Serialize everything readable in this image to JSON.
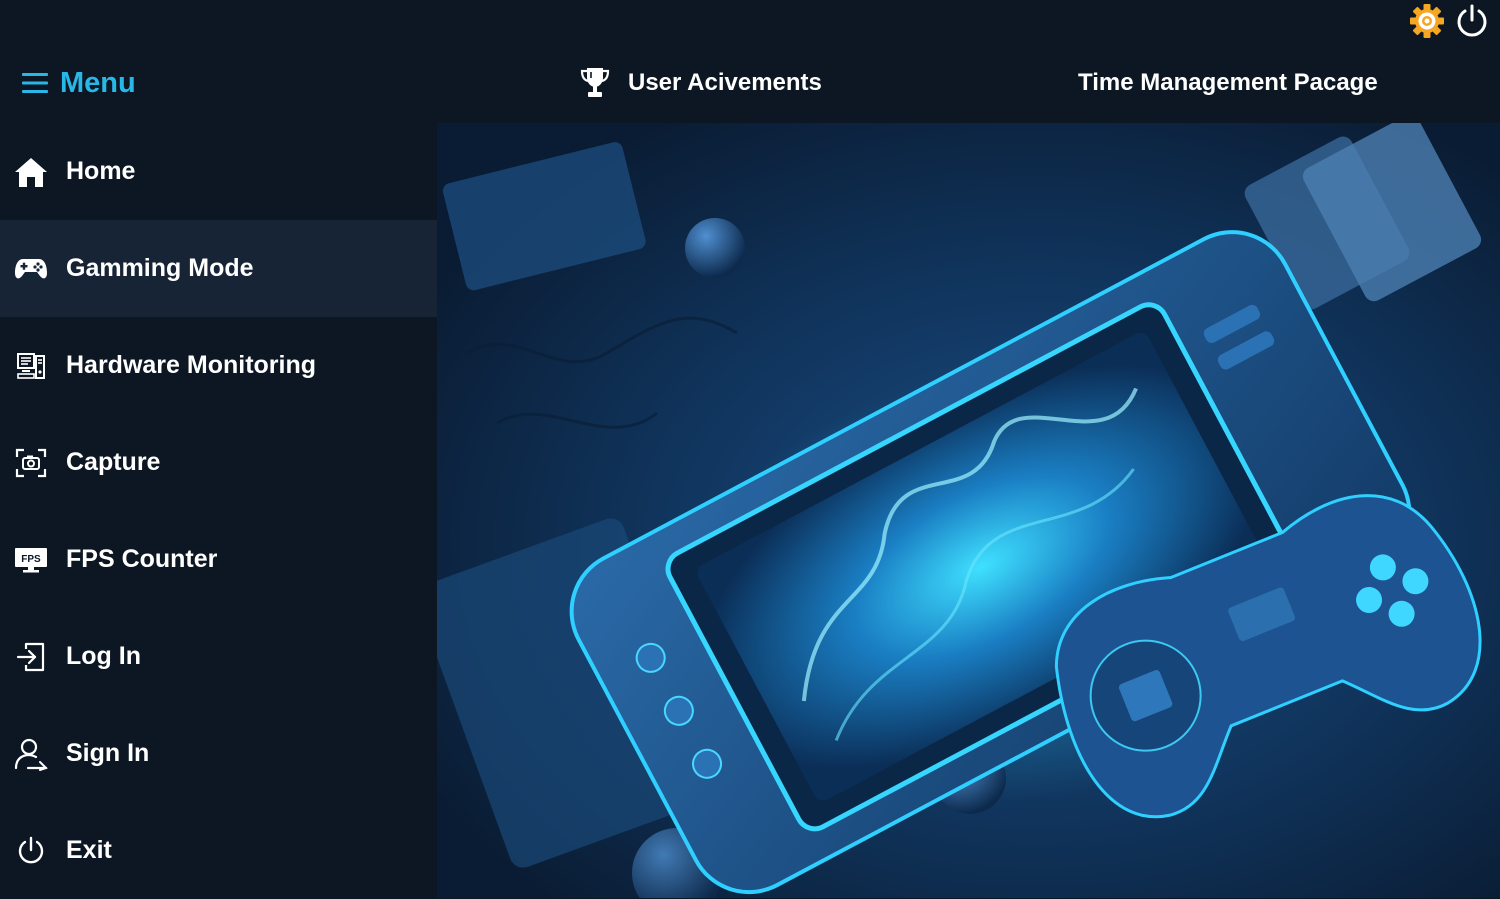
{
  "header": {
    "menu_label": "Menu",
    "achievements_label": "User Acivements",
    "time_management_label": "Time Management Pacage"
  },
  "window_controls": {
    "settings_icon": "gear-icon",
    "power_icon": "power-icon"
  },
  "sidebar": {
    "active_index": 1,
    "items": [
      {
        "label": "Home",
        "icon": "home-icon"
      },
      {
        "label": "Gamming Mode",
        "icon": "gamepad-icon"
      },
      {
        "label": "Hardware Monitoring",
        "icon": "hardware-monitor-icon"
      },
      {
        "label": "Capture",
        "icon": "camera-icon"
      },
      {
        "label": "FPS Counter",
        "icon": "fps-monitor-icon"
      },
      {
        "label": "Log In",
        "icon": "login-icon"
      },
      {
        "label": "Sign In",
        "icon": "user-add-icon"
      },
      {
        "label": "Exit",
        "icon": "power-icon"
      }
    ]
  },
  "colors": {
    "background": "#0c1723",
    "sidebar_active": "#172435",
    "accent": "#29b7e8",
    "gear": "#f5a623"
  }
}
